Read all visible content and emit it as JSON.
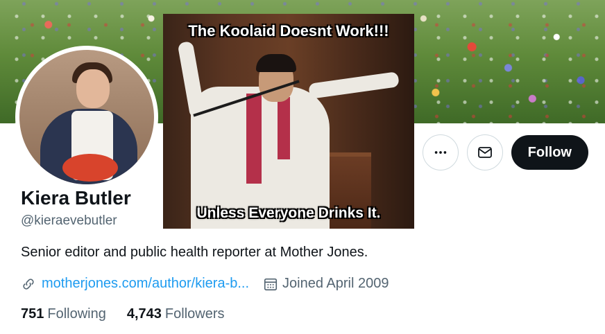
{
  "banner": {
    "description_icon": "wildflower-meadow-banner"
  },
  "meme": {
    "top_caption": "The Koolaid Doesnt Work!!!",
    "bottom_caption": "Unless Everyone Drinks It."
  },
  "profile": {
    "name": "Kiera Butler",
    "handle": "@kieraevebutler",
    "bio": "Senior editor and public health reporter at Mother Jones.",
    "website": "motherjones.com/author/kiera-b...",
    "joined": "Joined April 2009",
    "following_count": "751",
    "following_label": "Following",
    "followers_count": "4,743",
    "followers_label": "Followers"
  },
  "actions": {
    "more_icon": "more-icon",
    "message_icon": "mail-icon",
    "follow_label": "Follow"
  },
  "colors": {
    "accent": "#1d9bf0",
    "text_primary": "#0f1419",
    "text_secondary": "#536471",
    "button_dark": "#0f1419"
  }
}
